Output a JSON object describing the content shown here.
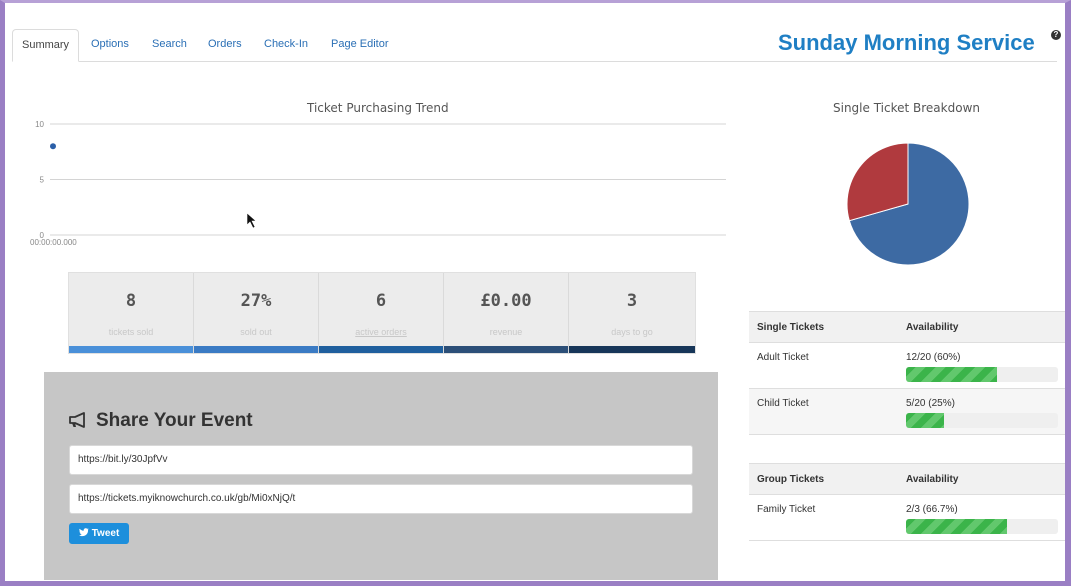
{
  "tabs": [
    {
      "label": "Summary",
      "active": true
    },
    {
      "label": "Options",
      "active": false
    },
    {
      "label": "Search",
      "active": false
    },
    {
      "label": "Orders",
      "active": false
    },
    {
      "label": "Check-In",
      "active": false
    },
    {
      "label": "Page Editor",
      "active": false
    }
  ],
  "event_title": "Sunday Morning Service",
  "help_icon": "?",
  "chart_data": [
    {
      "type": "scatter",
      "title": "Ticket Purchasing Trend",
      "yticks": [
        "10",
        "5",
        "0"
      ],
      "ylim": [
        0,
        10
      ],
      "x_start_label": "00:00:00.000",
      "points": [
        {
          "y": 8
        }
      ],
      "grid": true,
      "color": "#2b5fa8"
    },
    {
      "type": "pie",
      "title": "Single Ticket Breakdown",
      "slices": [
        {
          "label": "Adult Ticket",
          "value": 12,
          "color": "#3d6aa3"
        },
        {
          "label": "Child Ticket",
          "value": 5,
          "color": "#b03a3e"
        }
      ]
    }
  ],
  "stats": [
    {
      "value": "8",
      "label": "tickets sold",
      "color": "#4a90d9"
    },
    {
      "value": "27%",
      "label": "sold out",
      "color": "#3b7bc4"
    },
    {
      "value": "6",
      "label": "active orders",
      "color": "#1f5f9e"
    },
    {
      "value": "£0.00",
      "label": "revenue",
      "color": "#2c4f78"
    },
    {
      "value": "3",
      "label": "days to go",
      "color": "#173659"
    }
  ],
  "share": {
    "title": "Share Your Event",
    "short_url": "https://bit.ly/30JpfVv",
    "long_url": "https://tickets.myiknowchurch.co.uk/gb/Mi0xNjQ/t",
    "tweet_label": "Tweet",
    "icon": "megaphone-icon"
  },
  "single_tickets": {
    "header_name": "Single Tickets",
    "header_availability": "Availability",
    "rows": [
      {
        "name": "Adult Ticket",
        "availability": "12/20 (60%)",
        "fill": 0.6
      },
      {
        "name": "Child Ticket",
        "availability": "5/20 (25%)",
        "fill": 0.25
      }
    ]
  },
  "group_tickets": {
    "header_name": "Group Tickets",
    "header_availability": "Availability",
    "rows": [
      {
        "name": "Family Ticket",
        "availability": "2/3 (66.7%)",
        "fill": 0.667
      }
    ]
  }
}
